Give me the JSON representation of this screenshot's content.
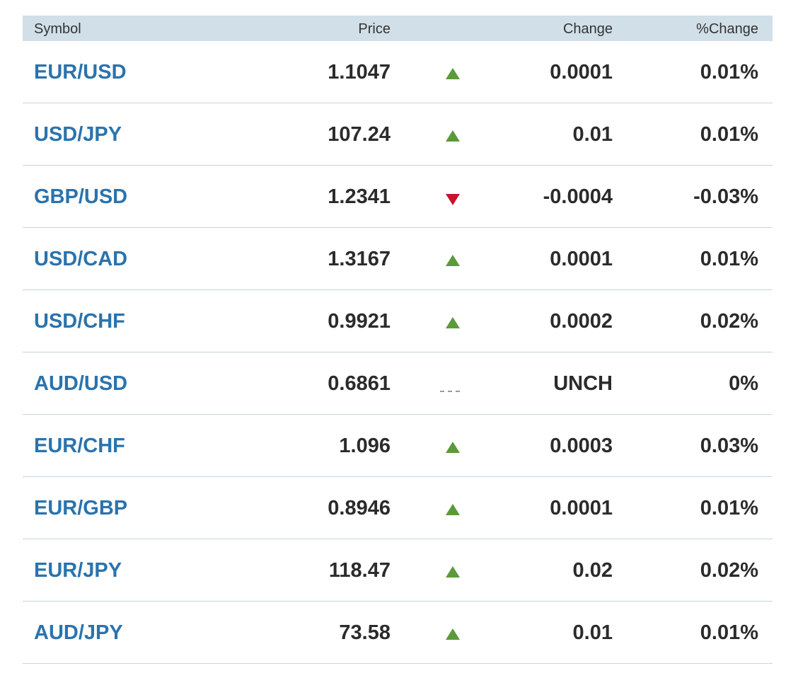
{
  "header": {
    "symbol": "Symbol",
    "price": "Price",
    "change": "Change",
    "pct_change": "%Change"
  },
  "rows": [
    {
      "symbol": "EUR/USD",
      "price": "1.1047",
      "direction": "up",
      "change": "0.0001",
      "pct": "0.01%"
    },
    {
      "symbol": "USD/JPY",
      "price": "107.24",
      "direction": "up",
      "change": "0.01",
      "pct": "0.01%"
    },
    {
      "symbol": "GBP/USD",
      "price": "1.2341",
      "direction": "down",
      "change": "-0.0004",
      "pct": "-0.03%"
    },
    {
      "symbol": "USD/CAD",
      "price": "1.3167",
      "direction": "up",
      "change": "0.0001",
      "pct": "0.01%"
    },
    {
      "symbol": "USD/CHF",
      "price": "0.9921",
      "direction": "up",
      "change": "0.0002",
      "pct": "0.02%"
    },
    {
      "symbol": "AUD/USD",
      "price": "0.6861",
      "direction": "flat",
      "change": "UNCH",
      "pct": "0%"
    },
    {
      "symbol": "EUR/CHF",
      "price": "1.096",
      "direction": "up",
      "change": "0.0003",
      "pct": "0.03%"
    },
    {
      "symbol": "EUR/GBP",
      "price": "0.8946",
      "direction": "up",
      "change": "0.0001",
      "pct": "0.01%"
    },
    {
      "symbol": "EUR/JPY",
      "price": "118.47",
      "direction": "up",
      "change": "0.02",
      "pct": "0.02%"
    },
    {
      "symbol": "AUD/JPY",
      "price": "73.58",
      "direction": "up",
      "change": "0.01",
      "pct": "0.01%"
    }
  ],
  "colors": {
    "symbol_link": "#2a73ad",
    "up": "#5a9a3a",
    "down": "#c8142c",
    "flat": "#9a9a9a",
    "header_bg": "#d1dfe8"
  },
  "icons": {
    "up": "triangle-up-icon",
    "down": "triangle-down-icon",
    "flat": "dash-icon"
  }
}
